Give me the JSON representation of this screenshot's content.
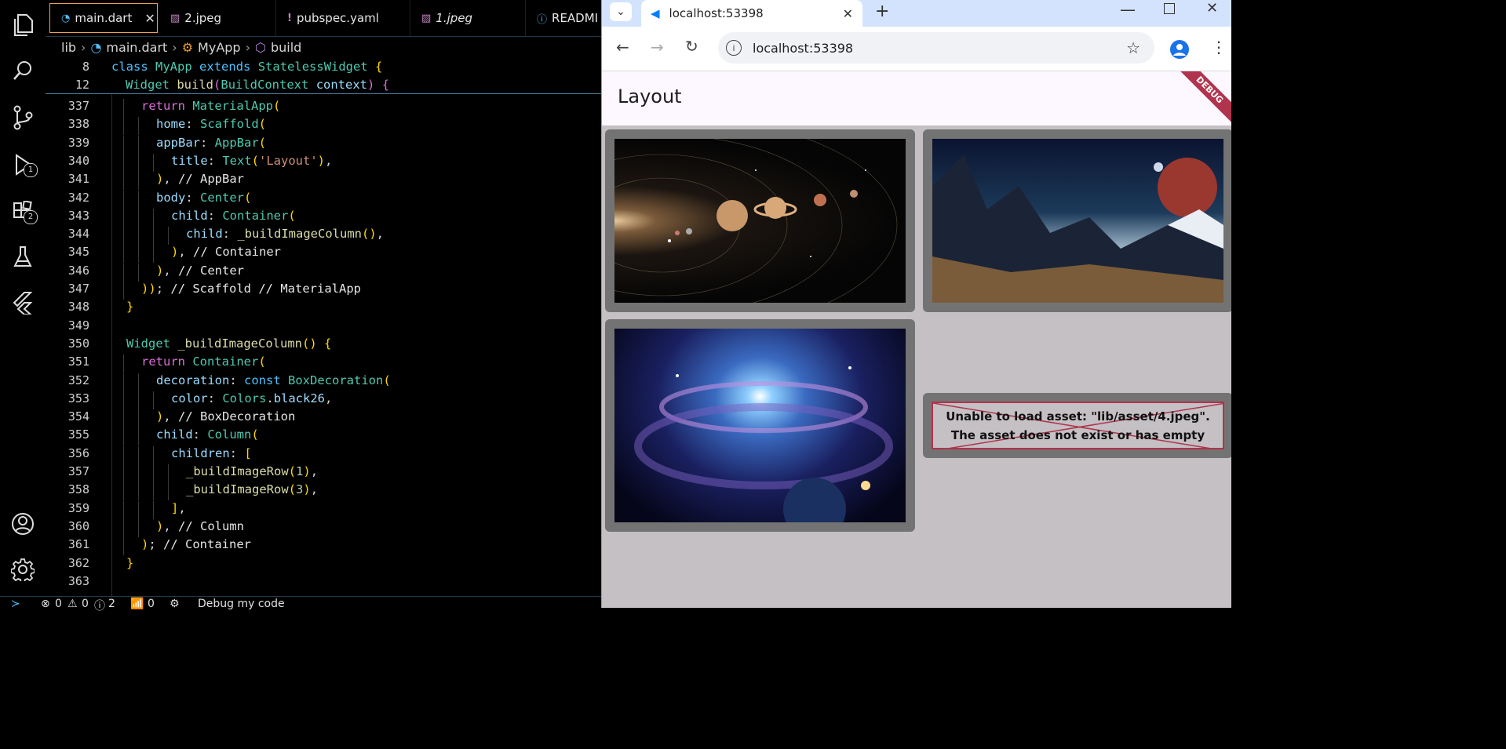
{
  "editor": {
    "tabs": [
      {
        "label": "main.dart",
        "icon": "dart-icon",
        "active": true
      },
      {
        "label": "2.jpeg",
        "icon": "image-icon"
      },
      {
        "label": "pubspec.yaml",
        "icon": "yaml-icon"
      },
      {
        "label": "1.jpeg",
        "icon": "image-icon"
      },
      {
        "label": "READMI",
        "icon": "info-icon"
      }
    ],
    "breadcrumb": [
      "lib",
      "main.dart",
      "MyApp",
      "build"
    ],
    "sticky": [
      {
        "line": "8",
        "text": "class MyApp extends StatelessWidget {"
      },
      {
        "line": "12",
        "text": "Widget build(BuildContext context) {"
      }
    ],
    "lines": [
      {
        "n": "337",
        "text": "return MaterialApp("
      },
      {
        "n": "338",
        "text": "home: Scaffold("
      },
      {
        "n": "339",
        "text": "appBar: AppBar("
      },
      {
        "n": "340",
        "text": "title: Text('Layout'),"
      },
      {
        "n": "341",
        "text": "), // AppBar"
      },
      {
        "n": "342",
        "text": "body: Center("
      },
      {
        "n": "343",
        "text": "child: Container("
      },
      {
        "n": "344",
        "text": "child: _buildImageColumn(),"
      },
      {
        "n": "345",
        "text": "), // Container"
      },
      {
        "n": "346",
        "text": "), // Center"
      },
      {
        "n": "347",
        "text": ")); // Scaffold // MaterialApp"
      },
      {
        "n": "348",
        "text": "}"
      },
      {
        "n": "349",
        "text": ""
      },
      {
        "n": "350",
        "text": "Widget _buildImageColumn() {"
      },
      {
        "n": "351",
        "text": "return Container("
      },
      {
        "n": "352",
        "text": "decoration: const BoxDecoration("
      },
      {
        "n": "353",
        "text": "color: Colors.black26,"
      },
      {
        "n": "354",
        "text": "), // BoxDecoration"
      },
      {
        "n": "355",
        "text": "child: Column("
      },
      {
        "n": "356",
        "text": "children: ["
      },
      {
        "n": "357",
        "text": "_buildImageRow(1),"
      },
      {
        "n": "358",
        "text": "_buildImageRow(3),"
      },
      {
        "n": "359",
        "text": "],"
      },
      {
        "n": "360",
        "text": "), // Column"
      },
      {
        "n": "361",
        "text": "); // Container"
      },
      {
        "n": "362",
        "text": "}"
      },
      {
        "n": "363",
        "text": ""
      }
    ]
  },
  "activity": {
    "debug_badge": "1",
    "extensions_badge": "2"
  },
  "status": {
    "errors": "0",
    "warnings": "0",
    "info_count": "0",
    "info_count2": "2",
    "ports": "0",
    "debug_label": "Debug my code"
  },
  "browser": {
    "tab_title": "localhost:53398",
    "url": "localhost:53398",
    "app_title": "Layout",
    "debug_banner": "DEBUG",
    "error_line1": "Unable to load asset: \"lib/asset/4.jpeg\".",
    "error_line2": "The asset does not exist or has empty data.",
    "images": [
      "solar-system",
      "alien-landscape",
      "galaxy"
    ]
  },
  "colors": {
    "accent": "#f0a050",
    "debug": "#b0344d",
    "browser_frame": "#d3e3fd",
    "body_bg": "#c4c0c4",
    "card": "#737373"
  }
}
